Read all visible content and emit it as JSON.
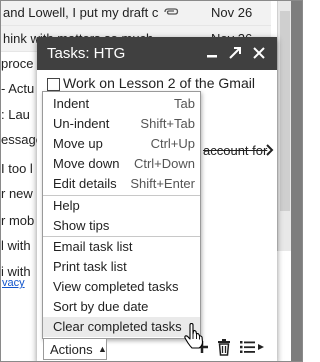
{
  "inbox": {
    "rows": [
      {
        "subject": "and Lowell, I put my draft c",
        "date": "Nov 26",
        "attachment_icon": "paperclip-icon"
      },
      {
        "subject": "hink with matters so much.",
        "date": "Nov 26"
      }
    ],
    "left_fragments": [
      "proce",
      "- Actu",
      ": Lau",
      "essage",
      "I too l",
      "r new",
      "r mob",
      "l with",
      "i with"
    ],
    "privacy_fragment": "vacy"
  },
  "tasks": {
    "title": "Tasks: HTG",
    "header_icons": [
      "minimize-icon",
      "pop-out-icon",
      "close-icon"
    ],
    "items": [
      {
        "text": "Work on Lesson 2 of the Gmail",
        "checked": false
      }
    ],
    "partial_task_text": "account for"
  },
  "actions_menu": {
    "groups": [
      [
        {
          "label": "Indent",
          "shortcut": "Tab"
        },
        {
          "label": "Un-indent",
          "shortcut": "Shift+Tab"
        },
        {
          "label": "Move up",
          "shortcut": "Ctrl+Up"
        },
        {
          "label": "Move down",
          "shortcut": "Ctrl+Down"
        },
        {
          "label": "Edit details",
          "shortcut": "Shift+Enter"
        }
      ],
      [
        {
          "label": "Help"
        },
        {
          "label": "Show tips"
        }
      ],
      [
        {
          "label": "Email task list"
        },
        {
          "label": "Print task list"
        },
        {
          "label": "View completed tasks"
        },
        {
          "label": "Sort by due date"
        },
        {
          "label": "Clear completed tasks",
          "highlighted": true
        }
      ]
    ]
  },
  "toolbar": {
    "actions_label": "Actions",
    "icons": [
      "add-task-icon",
      "delete-task-icon",
      "switch-list-icon"
    ]
  },
  "colors": {
    "tasks_header": "#404040",
    "menu_highlight": "#eaeaea",
    "link": "#1155cc"
  }
}
